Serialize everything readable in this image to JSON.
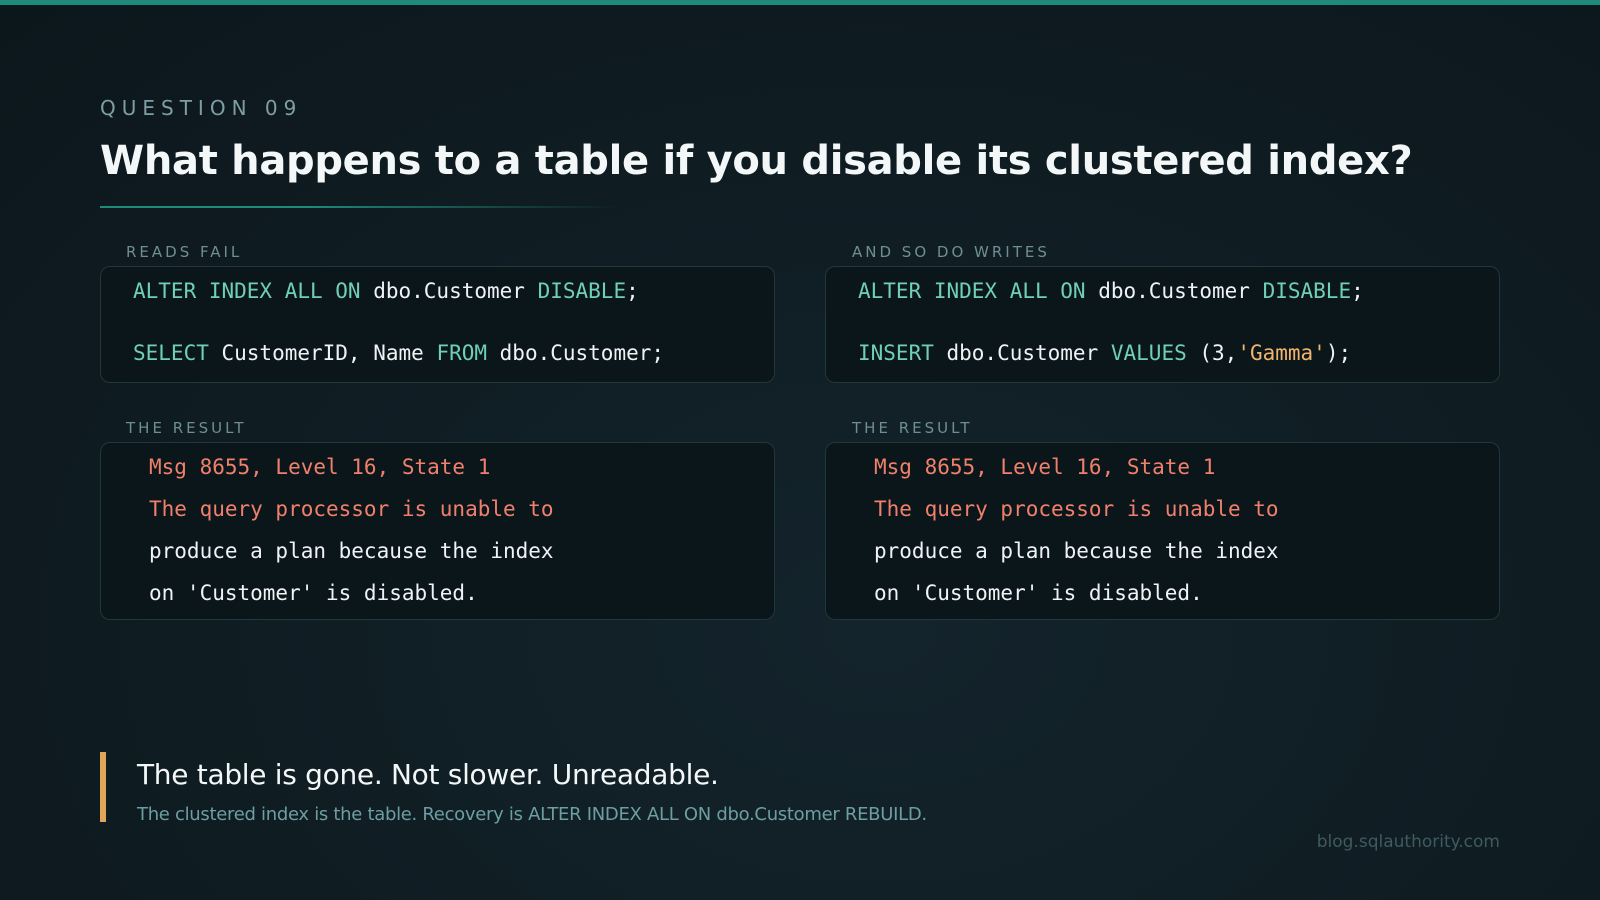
{
  "header": {
    "eyebrow": "QUESTION 09",
    "title": "What happens to a table if you disable its clustered index?"
  },
  "colors": {
    "accent": "#1e8a7a",
    "keyword": "#6fd0b6",
    "string": "#f2b46a",
    "error": "#f0806c",
    "callout_bar": "#e0a559"
  },
  "panels": [
    {
      "label": "READS FAIL",
      "code": {
        "line1": {
          "t1": "ALTER INDEX ALL ON",
          "t2": " dbo.Customer ",
          "t3": "DISABLE",
          "t4": ";"
        },
        "line2": {
          "t1": "SELECT",
          "t2": " CustomerID, Name ",
          "t3": "FROM",
          "t4": " dbo.Customer;"
        }
      },
      "result_label": "THE RESULT",
      "result": {
        "line1": "Msg 8655, Level 16, State 1",
        "line2": "The query processor is unable to",
        "line3": "produce a plan because the index",
        "line4": "on 'Customer' is disabled."
      }
    },
    {
      "label": "AND SO DO WRITES",
      "code": {
        "line1": {
          "t1": "ALTER INDEX ALL ON",
          "t2": " dbo.Customer ",
          "t3": "DISABLE",
          "t4": ";"
        },
        "line2": {
          "t1": "INSERT",
          "t2": " dbo.Customer ",
          "t3": "VALUES",
          "t4": " (3,",
          "t5": "'Gamma'",
          "t6": ");"
        }
      },
      "result_label": "THE RESULT",
      "result": {
        "line1": "Msg 8655, Level 16, State 1",
        "line2": "The query processor is unable to",
        "line3": "produce a plan because the index",
        "line4": "on 'Customer' is disabled."
      }
    }
  ],
  "callout": {
    "main": "The table is gone. Not slower. Unreadable.",
    "sub": "The clustered index is the table. Recovery is ALTER INDEX ALL ON dbo.Customer REBUILD."
  },
  "footer": {
    "source": "blog.sqlauthority.com"
  }
}
